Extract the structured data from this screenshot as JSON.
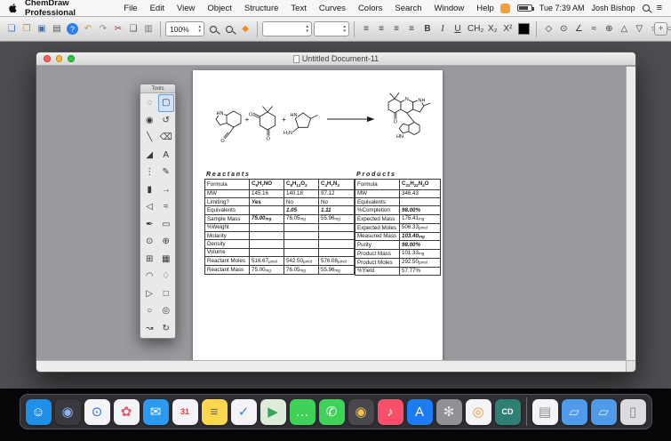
{
  "menubar": {
    "app_name": "ChemDraw Professional",
    "menus": [
      "File",
      "Edit",
      "View",
      "Object",
      "Structure",
      "Text",
      "Curves",
      "Colors",
      "Search",
      "Window",
      "Help"
    ],
    "status": {
      "clock": "Tue 7:39 AM",
      "user": "Josh Bishop"
    }
  },
  "icons": {
    "diamond": "◆",
    "step_up": "▲",
    "step_down": "▼",
    "notification_center": "≡",
    "plus": "+"
  },
  "toolbar": {
    "zoom_value": "100%",
    "swatch_color": "#000000",
    "file_group": [
      {
        "name": "new-document-button",
        "g": "❏",
        "c": "#3b6fd4"
      },
      {
        "name": "open-button",
        "g": "❐",
        "c": "#b98a3a"
      },
      {
        "name": "save-button",
        "g": "▣",
        "c": "#4a6da8"
      },
      {
        "name": "print-button",
        "g": "▤",
        "c": "#555555"
      },
      {
        "name": "help-button",
        "g": "?",
        "cls": "help-round"
      },
      {
        "name": "undo-button",
        "g": "↶",
        "c": "#c79b2e"
      },
      {
        "name": "redo-button",
        "g": "↷",
        "c": "#8a8a8a"
      },
      {
        "name": "cut-button",
        "g": "✂",
        "c": "#a03333"
      },
      {
        "name": "copy-button",
        "g": "❑",
        "c": "#555555"
      },
      {
        "name": "paste-button",
        "g": "▥",
        "c": "#777777"
      }
    ],
    "align_group": [
      {
        "name": "align-left-button",
        "g": "≡"
      },
      {
        "name": "align-center-button",
        "g": "≡"
      },
      {
        "name": "align-right-button",
        "g": "≡"
      },
      {
        "name": "align-justify-button",
        "g": "≡"
      }
    ],
    "text_group": [
      {
        "name": "bold-button",
        "g": "B"
      },
      {
        "name": "italic-button",
        "g": "I"
      },
      {
        "name": "underline-button",
        "g": "U"
      }
    ],
    "chem_style_group": [
      {
        "name": "formula-style-button",
        "g": "CH₂"
      },
      {
        "name": "subscript-button",
        "g": "X₂"
      },
      {
        "name": "superscript-button",
        "g": "X²"
      }
    ],
    "chem_group": [
      {
        "name": "clean-structure-button",
        "g": "◇"
      },
      {
        "name": "ring-perception-button",
        "g": "⊙"
      },
      {
        "name": "angle-tool-button",
        "g": "∠"
      },
      {
        "name": "wave-bond-button",
        "g": "≈"
      },
      {
        "name": "charge-tool-button",
        "g": "⊕"
      },
      {
        "name": "up-stereo-button",
        "g": "△"
      },
      {
        "name": "down-stereo-button",
        "g": "▽"
      },
      {
        "name": "star-annotation-button",
        "g": "☆"
      },
      {
        "name": "circle-annotation-button",
        "g": "○"
      }
    ]
  },
  "window": {
    "title": "Untitled Document-11",
    "lights": [
      "#ff5f57",
      "#febc2e",
      "#28c840"
    ]
  },
  "tools": {
    "title": "Tools",
    "items": [
      {
        "name": "lasso-tool",
        "g": "◌"
      },
      {
        "name": "marquee-tool",
        "g": "▢",
        "active": true
      },
      {
        "name": "structure-perspective-tool",
        "g": "◉"
      },
      {
        "name": "rotate-tool",
        "g": "↺"
      },
      {
        "name": "solid-bond-tool",
        "g": "╲"
      },
      {
        "name": "eraser-tool",
        "g": "⌫"
      },
      {
        "name": "wedge-bond-tool",
        "g": "◢"
      },
      {
        "name": "text-tool",
        "g": "A"
      },
      {
        "name": "dashed-bond-tool",
        "g": "⋮"
      },
      {
        "name": "pencil-tool",
        "g": "✎"
      },
      {
        "name": "bold-bond-tool",
        "g": "▮"
      },
      {
        "name": "arrow-tool",
        "g": "→"
      },
      {
        "name": "hollow-wedge-tool",
        "g": "◁"
      },
      {
        "name": "chain-tool",
        "g": "≈"
      },
      {
        "name": "pen-tool",
        "g": "✒"
      },
      {
        "name": "rectangle-tool",
        "g": "▭"
      },
      {
        "name": "orbital-tool",
        "g": "⊙"
      },
      {
        "name": "symbol-tool",
        "g": "⊕"
      },
      {
        "name": "table-tool",
        "g": "⊞"
      },
      {
        "name": "template-tool",
        "g": "▦"
      },
      {
        "name": "arc-tool",
        "g": "◠"
      },
      {
        "name": "shape-tool",
        "g": "♢"
      },
      {
        "name": "triangle-tool",
        "g": "▷"
      },
      {
        "name": "square-tool",
        "g": "□"
      },
      {
        "name": "circle-tool",
        "g": "○"
      },
      {
        "name": "ellipse-tool",
        "g": "◎"
      },
      {
        "name": "curved-arrow-tool",
        "g": "↝"
      },
      {
        "name": "cycle-tool",
        "g": "↻"
      }
    ]
  },
  "scheme": {
    "plus": "+",
    "r1_hn": "HN",
    "r1_o": "O",
    "r2_o1": "O",
    "r2_o2": "O",
    "r3_hn": "HN",
    "r3_h2n": "H₂N",
    "p_n": "N",
    "p_nh": "NH",
    "p_o": "O",
    "p_hn": "HN"
  },
  "stoich": {
    "reactants": {
      "header": "Reactants",
      "rows": [
        {
          "label": "Formula",
          "formula": true,
          "cells": [
            {
              "v": "C9H7NO",
              "s": "bd"
            },
            {
              "v": "C8H12O2",
              "s": "bd"
            },
            {
              "v": "C4H7N3",
              "s": "bd"
            }
          ]
        },
        {
          "label": "MW",
          "cells": [
            {
              "v": "145.16"
            },
            {
              "v": "140.18"
            },
            {
              "v": "97.12"
            }
          ]
        },
        {
          "label": "Limiting?",
          "cells": [
            {
              "v": "Yes",
              "s": "bi"
            },
            {
              "v": "No"
            },
            {
              "v": "No"
            }
          ]
        },
        {
          "label": "Equivalents",
          "cells": [
            {},
            {
              "v": "1.05",
              "s": "bi"
            },
            {
              "v": "1.11",
              "s": "bi"
            }
          ]
        },
        {
          "label": "Sample Mass",
          "cells": [
            {
              "v": "75.00",
              "u": "mg",
              "s": "bi"
            },
            {
              "v": "76.05",
              "u": "mg"
            },
            {
              "v": "55.96",
              "u": "mg"
            }
          ]
        },
        {
          "label": "%Weight",
          "cells": [
            {},
            {},
            {}
          ]
        },
        {
          "label": "Molarity",
          "cells": [
            {},
            {},
            {}
          ]
        },
        {
          "label": "Density",
          "cells": [
            {},
            {},
            {}
          ]
        },
        {
          "label": "Volume",
          "cells": [
            {},
            {},
            {}
          ]
        },
        {
          "label": "Reactant Moles",
          "cells": [
            {
              "v": "516.67",
              "u": "µmol"
            },
            {
              "v": "542.50",
              "u": "µmol"
            },
            {
              "v": "576.08",
              "u": "µmol"
            }
          ]
        },
        {
          "label": "Reactant Mass",
          "cells": [
            {
              "v": "75.00",
              "u": "mg"
            },
            {
              "v": "76.05",
              "u": "mg"
            },
            {
              "v": "55.96",
              "u": "mg"
            }
          ]
        }
      ]
    },
    "products": {
      "header": "Products",
      "rows": [
        {
          "label": "Formula",
          "formula": true,
          "cells": [
            {
              "v": "C21H22N4O",
              "s": "bd"
            }
          ]
        },
        {
          "label": "MW",
          "cells": [
            {
              "v": "346.43"
            }
          ]
        },
        {
          "label": "Equivalents",
          "cells": [
            {}
          ]
        },
        {
          "label": "%Completion",
          "cells": [
            {
              "v": "98.00%",
              "s": "bi"
            }
          ]
        },
        {
          "label": "Expected Mass",
          "cells": [
            {
              "v": "175.41",
              "u": "mg"
            }
          ]
        },
        {
          "label": "Expected Moles",
          "cells": [
            {
              "v": "506.33",
              "u": "µmol"
            }
          ]
        },
        {
          "label": "Measured Mass",
          "cells": [
            {
              "v": "103.40",
              "u": "mg",
              "s": "bi"
            }
          ]
        },
        {
          "label": "Purity",
          "cells": [
            {
              "v": "98.00%",
              "s": "bi"
            }
          ]
        },
        {
          "label": "Product Mass",
          "cells": [
            {
              "v": "101.33",
              "u": "mg"
            }
          ]
        },
        {
          "label": "Product Moles",
          "cells": [
            {
              "v": "292.50",
              "u": "µmol"
            }
          ]
        },
        {
          "label": "%Yield",
          "cells": [
            {
              "v": "57.77%"
            }
          ]
        }
      ]
    }
  },
  "dock": {
    "items": [
      {
        "name": "finder",
        "g": "☺",
        "bg": "#1f8fe8"
      },
      {
        "name": "siri",
        "g": "◉",
        "bg": "#3a3a3e",
        "fg": "#8ab4f8"
      },
      {
        "name": "safari",
        "g": "⊙",
        "bg": "#f4f4f6",
        "fg": "#2f6fed"
      },
      {
        "name": "photos",
        "g": "✿",
        "bg": "#f4f4f6",
        "fg": "#e0566e"
      },
      {
        "name": "mail",
        "g": "✉",
        "bg": "#2b9af3"
      },
      {
        "name": "calendar",
        "g": "31",
        "bg": "#f4f4f6",
        "fg": "#e03e3e",
        "small": true
      },
      {
        "name": "notes",
        "g": "≡",
        "bg": "#fdd84e",
        "fg": "#6b6b6b"
      },
      {
        "name": "reminders",
        "g": "✓",
        "bg": "#f4f4f6",
        "fg": "#3478f6"
      },
      {
        "name": "maps",
        "g": "▶",
        "bg": "#dcecd8",
        "fg": "#34a853"
      },
      {
        "name": "messages",
        "g": "…",
        "bg": "#3fd159"
      },
      {
        "name": "facetime",
        "g": "✆",
        "bg": "#3fd159"
      },
      {
        "name": "photo-booth",
        "g": "◉",
        "bg": "#48484c",
        "fg": "#f2c14e"
      },
      {
        "name": "music",
        "g": "♪",
        "bg": "#fa4f68"
      },
      {
        "name": "app-store",
        "g": "A",
        "bg": "#1d7bf5"
      },
      {
        "name": "settings",
        "g": "✻",
        "bg": "#909095",
        "fg": "#e8e8e8"
      },
      {
        "name": "browser",
        "g": "◎",
        "bg": "#f4f4f6",
        "fg": "#e8973d"
      },
      {
        "name": "cd",
        "g": "CD",
        "bg": "#2f7f74",
        "small": true
      },
      {
        "sep": true
      },
      {
        "name": "textedit",
        "g": "▤",
        "bg": "#f4f4f6",
        "fg": "#8a8a8a"
      },
      {
        "name": "folder-downloads",
        "g": "▱",
        "bg": "#4f9bea",
        "fg": "#d8e8fa"
      },
      {
        "name": "folder-documents",
        "g": "▱",
        "bg": "#4f9bea",
        "fg": "#d8e8fa"
      },
      {
        "name": "trash",
        "g": "▯",
        "bg": "#dcdce0",
        "fg": "#86868a"
      }
    ]
  }
}
